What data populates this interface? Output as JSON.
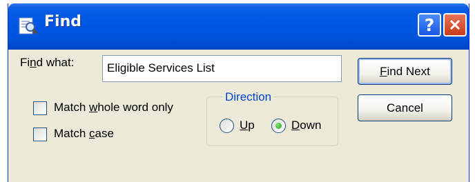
{
  "window": {
    "title": "Find",
    "help_glyph": "?",
    "icon": "find-icon",
    "colors": {
      "titlebar": "#0058e6",
      "body": "#ece9d8",
      "group_title": "#0046d5",
      "close": "#c93c18"
    }
  },
  "find_what": {
    "label_pre": "Fi",
    "label_key": "n",
    "label_post": "d what:",
    "value": "Eligible Services List"
  },
  "buttons": {
    "find_next": {
      "key": "F",
      "rest": "ind Next"
    },
    "cancel": {
      "label": "Cancel"
    }
  },
  "options": {
    "match_whole_word": {
      "pre": "Match ",
      "key": "w",
      "post": "hole word only",
      "checked": false
    },
    "match_case": {
      "pre": "Match ",
      "key": "c",
      "post": "ase",
      "checked": false
    }
  },
  "direction": {
    "title": "Direction",
    "up": {
      "key": "U",
      "rest": "p",
      "selected": false
    },
    "down": {
      "key": "D",
      "rest": "own",
      "selected": true
    }
  }
}
